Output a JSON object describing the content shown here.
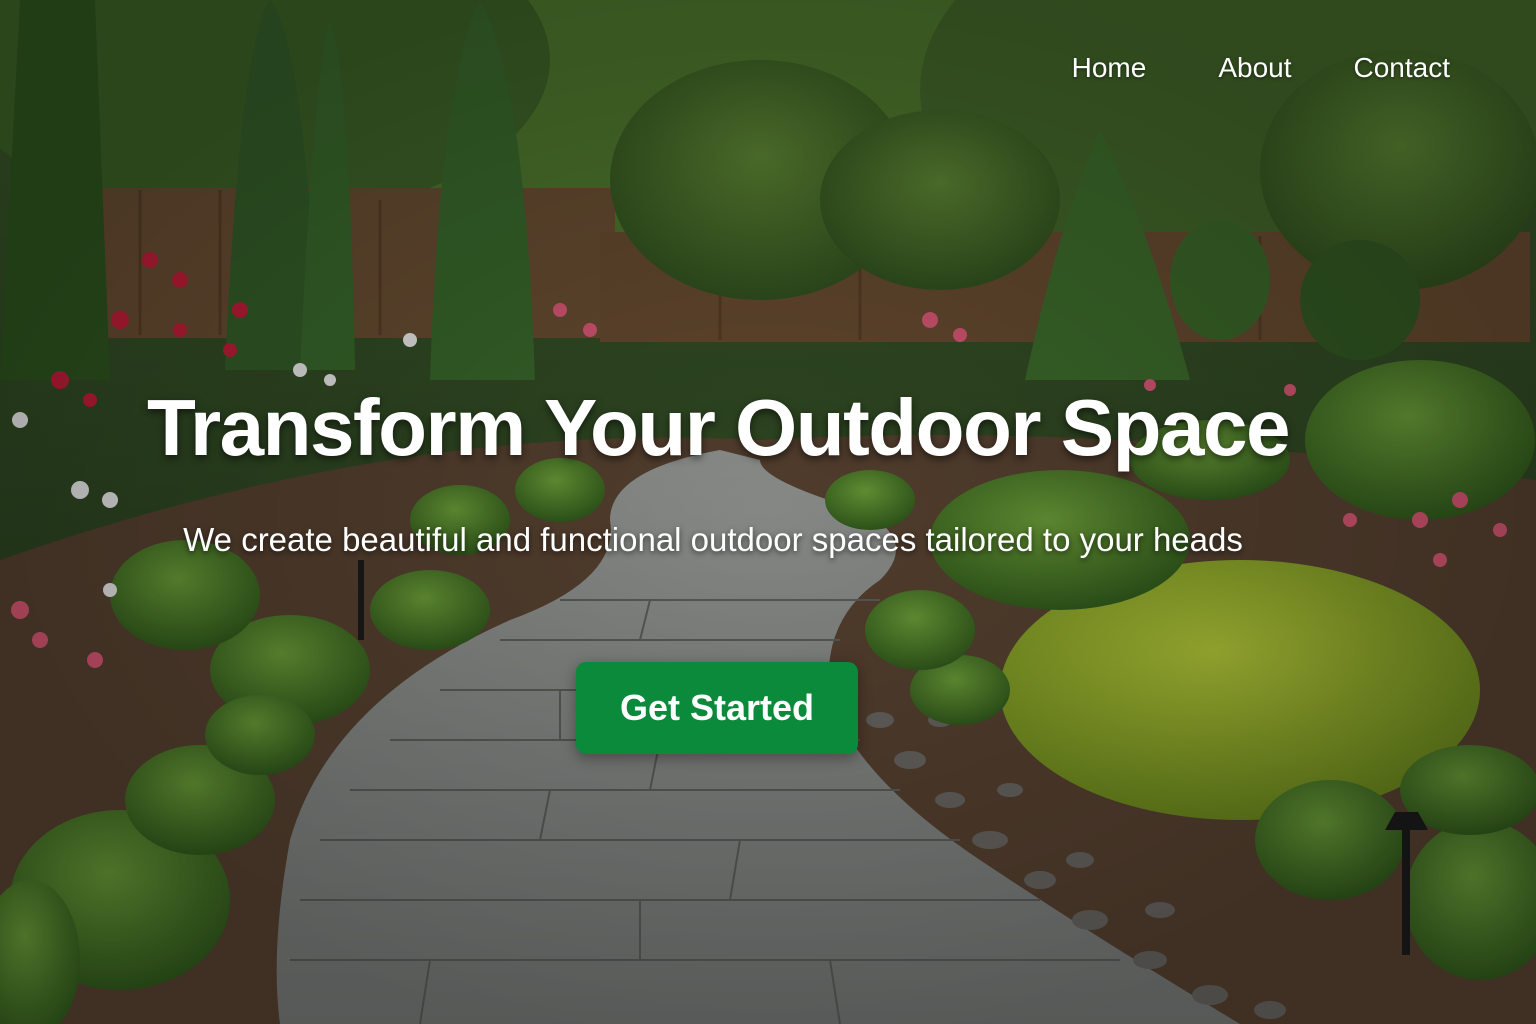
{
  "nav": {
    "items": [
      {
        "label": "Home"
      },
      {
        "label": "About"
      },
      {
        "label": "Contact"
      }
    ]
  },
  "hero": {
    "title": "Transform Your Outdoor Space",
    "subtitle": "We create beautiful and functional outdoor spaces tailored to your heads",
    "cta_label": "Get Started",
    "background_image": "garden-with-stone-path-photo"
  },
  "colors": {
    "cta_background": "#0a8a3a",
    "text": "#ffffff"
  }
}
